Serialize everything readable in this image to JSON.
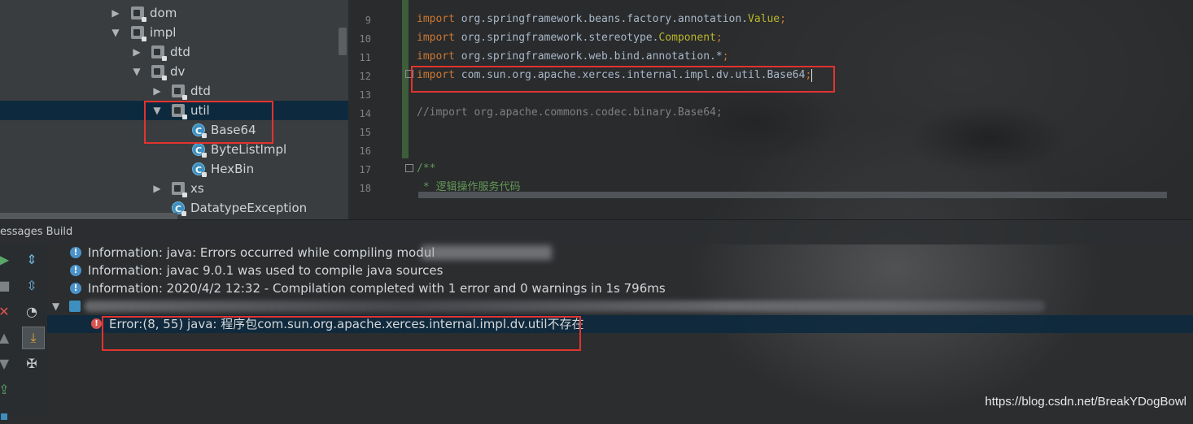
{
  "project_tree": {
    "items": [
      {
        "label": "dom",
        "type": "package",
        "expanded": false
      },
      {
        "label": "impl",
        "type": "package",
        "expanded": true
      },
      {
        "label": "dtd",
        "type": "package",
        "expanded": false
      },
      {
        "label": "dv",
        "type": "package",
        "expanded": true
      },
      {
        "label": "dtd",
        "type": "package",
        "expanded": false
      },
      {
        "label": "util",
        "type": "package",
        "expanded": true,
        "selected": true
      },
      {
        "label": "Base64",
        "type": "class"
      },
      {
        "label": "ByteListImpl",
        "type": "class"
      },
      {
        "label": "HexBin",
        "type": "class"
      },
      {
        "label": "xs",
        "type": "package",
        "expanded": false
      },
      {
        "label": "DatatypeException",
        "type": "class"
      }
    ]
  },
  "editor": {
    "line_numbers": [
      "9",
      "10",
      "11",
      "12",
      "13",
      "14",
      "15",
      "16",
      "17",
      "18"
    ],
    "lines": [
      {
        "kw": "import",
        "text": " org.springframework.beans.factory.annotation.",
        "ann": "Value",
        "end": ";"
      },
      {
        "kw": "import",
        "text": " org.springframework.stereotype.",
        "ann": "Component",
        "end": ";"
      },
      {
        "kw": "import",
        "text": " org.springframework.web.bind.annotation.*",
        "ann": "",
        "end": ";"
      },
      {
        "kw": "import",
        "text": " com.sun.org.apache.xerces.internal.impl.dv.util.Base64",
        "ann": "",
        "end": ";"
      },
      {
        "comment": ""
      },
      {
        "comment": "//import org.apache.commons.codec.binary.Base64;"
      },
      {
        "comment": ""
      },
      {
        "comment": ""
      },
      {
        "doc": "/**"
      },
      {
        "doc": " * 逻辑操作服务代码"
      }
    ]
  },
  "build_panel": {
    "tab_label": "essages Build",
    "messages": [
      {
        "level": "info",
        "text": "Information: java: Errors occurred while compiling modul"
      },
      {
        "level": "info",
        "text": "Information: javac 9.0.1 was used to compile java sources"
      },
      {
        "level": "info",
        "text": "Information: 2020/4/2 12:32 - Compilation completed with 1 error and 0 warnings in 1s 796ms"
      },
      {
        "level": "error",
        "text": "Error:(8, 55)  java: 程序包com.sun.org.apache.xerces.internal.impl.dv.util不存在"
      }
    ]
  },
  "colors": {
    "keyword": "#cc7832",
    "annotation": "#bbb529",
    "comment": "#808080",
    "highlight_box": "#e2332f",
    "selection": "#0d293e"
  },
  "watermark": "https://blog.csdn.net/BreakYDogBowl"
}
